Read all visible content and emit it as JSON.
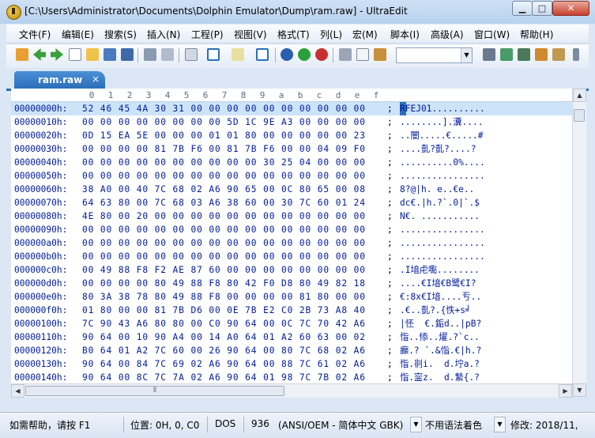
{
  "window": {
    "title": "[C:\\Users\\Administrator\\Documents\\Dolphin Emulator\\Dump\\ram.raw] - UltraEdit",
    "min_glyph": "▁",
    "max_glyph": "□",
    "close_glyph": "✕"
  },
  "menu": [
    "文件(F)",
    "编辑(E)",
    "搜索(S)",
    "插入(N)",
    "工程(P)",
    "视图(V)",
    "格式(T)",
    "列(L)",
    "宏(M)",
    "脚本(I)",
    "高级(A)",
    "窗口(W)",
    "帮助(H)"
  ],
  "toolbar": {
    "combo_value": "",
    "icons": [
      "open-icon",
      "back-icon",
      "forward-icon",
      "new-file-icon",
      "open-folder-icon",
      "save-icon",
      "save-all-icon",
      "print-icon",
      "print-preview-icon",
      "properties-icon",
      "hex-mode-icon",
      "column-mode-icon",
      "word-wrap-icon",
      "ftp-icon",
      "add-icon",
      "stop-icon",
      "cut-icon",
      "copy-icon",
      "paste-icon",
      "find-icon",
      "replace-icon",
      "macro-icon",
      "list-icon"
    ]
  },
  "tab": {
    "label": "ram.raw",
    "close": "×"
  },
  "ruler": [
    "0",
    "1",
    "2",
    "3",
    "4",
    "5",
    "6",
    "7",
    "8",
    "9",
    "a",
    "b",
    "c",
    "d",
    "e",
    "f"
  ],
  "rows": [
    {
      "addr": "00000000h:",
      "bytes": "52 46 45 4A 30 31 00 00 00 00 00 00 00 00 00 00",
      "sep": ";",
      "ascii": "RFEJ01.........."
    },
    {
      "addr": "00000010h:",
      "bytes": "00 00 00 00 00 00 00 00 5D 1C 9E A3 00 00 00 00",
      "sep": ";",
      "ascii": "........].瀵...."
    },
    {
      "addr": "00000020h:",
      "bytes": "0D 15 EA 5E 00 00 00 01 01 80 00 00 00 00 00 23",
      "sep": ";",
      "ascii": "..闇.....€.....#"
    },
    {
      "addr": "00000030h:",
      "bytes": "00 00 00 00 81 7B F6 00 81 7B F6 00 00 04 09 F0",
      "sep": ";",
      "ascii": "....亄?亄?....?"
    },
    {
      "addr": "00000040h:",
      "bytes": "00 00 00 00 00 00 00 00 00 00 30 25 04 00 00 00",
      "sep": ";",
      "ascii": "..........0%...."
    },
    {
      "addr": "00000050h:",
      "bytes": "00 00 00 00 00 00 00 00 00 00 00 00 00 00 00 00",
      "sep": ";",
      "ascii": "................"
    },
    {
      "addr": "00000060h:",
      "bytes": "38 A0 00 40 7C 68 02 A6 90 65 00 0C 80 65 00 08",
      "sep": ";",
      "ascii": "8?@|h. e..€e.."
    },
    {
      "addr": "00000070h:",
      "bytes": "64 63 80 00 7C 68 03 A6 38 60 00 30 7C 60 01 24",
      "sep": ";",
      "ascii": "dc€.|h.?`.0|`.$"
    },
    {
      "addr": "00000080h:",
      "bytes": "4E 80 00 20 00 00 00 00 00 00 00 00 00 00 00 00",
      "sep": ";",
      "ascii": "N€. ..........."
    },
    {
      "addr": "00000090h:",
      "bytes": "00 00 00 00 00 00 00 00 00 00 00 00 00 00 00 00",
      "sep": ";",
      "ascii": "................"
    },
    {
      "addr": "000000a0h:",
      "bytes": "00 00 00 00 00 00 00 00 00 00 00 00 00 00 00 00",
      "sep": ";",
      "ascii": "................"
    },
    {
      "addr": "000000b0h:",
      "bytes": "00 00 00 00 00 00 00 00 00 00 00 00 00 00 00 00",
      "sep": ";",
      "ascii": "................"
    },
    {
      "addr": "000000c0h:",
      "bytes": "00 49 88 F8 F2 AE 87 60 00 00 00 00 00 00 00 00",
      "sep": ";",
      "ascii": ".I堷虍嚸........"
    },
    {
      "addr": "000000d0h:",
      "bytes": "00 00 00 00 80 49 88 F8 80 42 F0 D8 80 49 82 18",
      "sep": ";",
      "ascii": "....€I堷€B鹭€I?"
    },
    {
      "addr": "000000e0h:",
      "bytes": "80 3A 38 78 80 49 88 F8 00 00 00 00 81 80 00 00",
      "sep": ";",
      "ascii": "€:8x€I堷....亐.."
    },
    {
      "addr": "000000f0h:",
      "bytes": "01 80 00 00 81 7B D6 00 0E 7B E2 C0 2B 73 A8 40",
      "sep": ";",
      "ascii": ".€..亄?.{怢+s╛"
    },
    {
      "addr": "00000100h:",
      "bytes": "7C 90 43 A6 80 80 00 C0 90 64 00 0C 7C 70 42 A6",
      "sep": ";",
      "ascii": "|怌  €.銗d..|pB?"
    },
    {
      "addr": "00000110h:",
      "bytes": "90 64 00 10 90 A4 00 14 A0 64 01 A2 60 63 00 02",
      "sep": ";",
      "ascii": "恉..悿..燿.?`c.."
    },
    {
      "addr": "00000120h:",
      "bytes": "B0 64 01 A2 7C 60 00 26 90 64 00 80 7C 68 02 A6",
      "sep": ";",
      "ascii": "癲.? `.&恉.€|h.?"
    },
    {
      "addr": "00000130h:",
      "bytes": "90 64 00 84 7C 69 02 A6 90 64 00 88 7C 61 02 A6",
      "sep": ";",
      "ascii": "恉.剕i.  d.坾a.?"
    },
    {
      "addr": "00000140h:",
      "bytes": "90 64 00 8C 7C 7A 02 A6 90 64 01 98 7C 7B 02 A6",
      "sep": ";",
      "ascii": "恉.寍z.  d.縶{.?"
    }
  ],
  "status": {
    "help": "如需帮助，请按 F1",
    "position": "位置: 0H, 0, C0",
    "line_ending": "DOS",
    "codepage_num": "936",
    "codepage": "(ANSI/OEM - 简体中文 GBK)",
    "highlight": "不用语法着色",
    "modified": "修改: 2018/11,"
  }
}
